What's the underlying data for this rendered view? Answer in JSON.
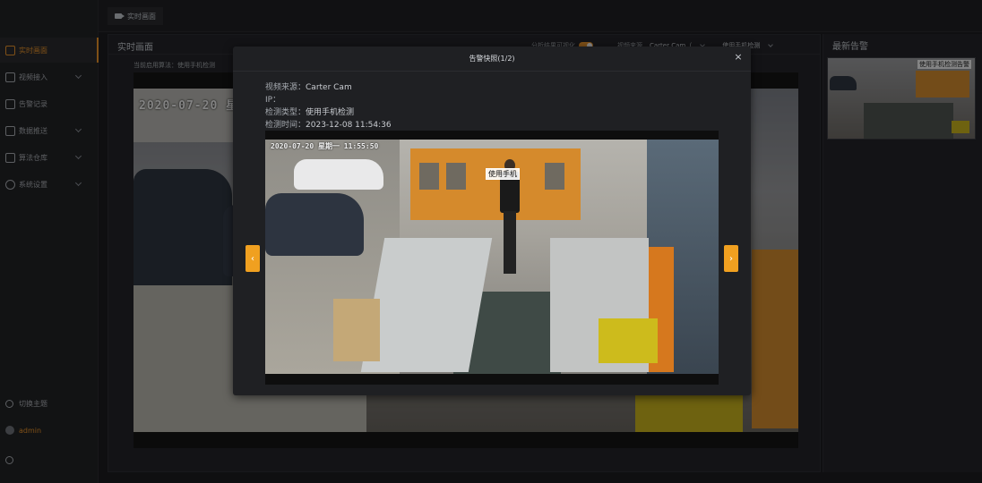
{
  "sidebar": {
    "items": [
      {
        "label": "实时画面",
        "icon": "monitor-icon",
        "active": true,
        "has_children": false
      },
      {
        "label": "视频接入",
        "icon": "video-icon",
        "active": false,
        "has_children": true
      },
      {
        "label": "告警记录",
        "icon": "document-icon",
        "active": false,
        "has_children": false
      },
      {
        "label": "数据推送",
        "icon": "database-icon",
        "active": false,
        "has_children": true
      },
      {
        "label": "算法仓库",
        "icon": "cube-icon",
        "active": false,
        "has_children": true
      },
      {
        "label": "系统设置",
        "icon": "gear-icon",
        "active": false,
        "has_children": true
      }
    ],
    "theme_label": "切换主题",
    "user_label": "admin"
  },
  "topbar": {
    "tab_label": "实时画面"
  },
  "main": {
    "title": "实时画面",
    "algo_prefix": "当前启用算法：",
    "algo_value": "使用手机检测",
    "toggle_label": "分析结果可视化",
    "source_label": "视频来源",
    "camera_select": "Carter Cam（",
    "algo_select": "使用手机检测",
    "video_date": "2020-07-20 星"
  },
  "alerts": {
    "title": "最新告警",
    "thumb_label": "使用手机检测告警"
  },
  "modal": {
    "title": "告警快照(1/2)",
    "close": "×",
    "source_key": "视频来源：",
    "source_val": "Carter Cam",
    "ip_key": "IP：",
    "ip_val": "",
    "type_key": "检测类型：",
    "type_val": "使用手机检测",
    "time_key": "检测时间：",
    "time_val": "2023-12-08 11:54:36",
    "snap_date": "2020-07-20 星期一 11:55:50",
    "detection_label": "使用手机",
    "prev": "‹",
    "next": "›"
  },
  "colors": {
    "accent": "#e8922a",
    "nav_button": "#f0a020"
  }
}
